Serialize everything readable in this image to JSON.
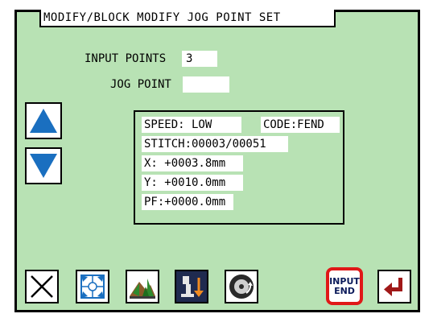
{
  "title": "MODIFY/BLOCK MODIFY  JOG POINT SET",
  "input_points": {
    "label": "INPUT POINTS",
    "value": "3"
  },
  "jog_point": {
    "label": "JOG POINT",
    "value": ""
  },
  "info": {
    "speed": "SPEED: LOW",
    "code": "CODE:FEND",
    "stitch": "STITCH:00003/00051",
    "x": "X:  +0003.8mm",
    "y": "Y:  +0010.0mm",
    "pf": "PF:+0000.0mm"
  },
  "buttons": {
    "input_end_line1": "INPUT",
    "input_end_line2": "END"
  },
  "icons": {
    "up": "up-arrow-icon",
    "down": "down-arrow-icon",
    "cancel": "close-icon",
    "expand": "expand-icon",
    "landscape": "tree-landscape-icon",
    "presser": "presser-down-icon",
    "rotate": "rotate-gear-icon",
    "enter": "enter-icon"
  },
  "colors": {
    "screen": "#b8e2b4",
    "highlight": "#e01818",
    "arrow": "#1a6fc0",
    "enter": "#a01818"
  }
}
